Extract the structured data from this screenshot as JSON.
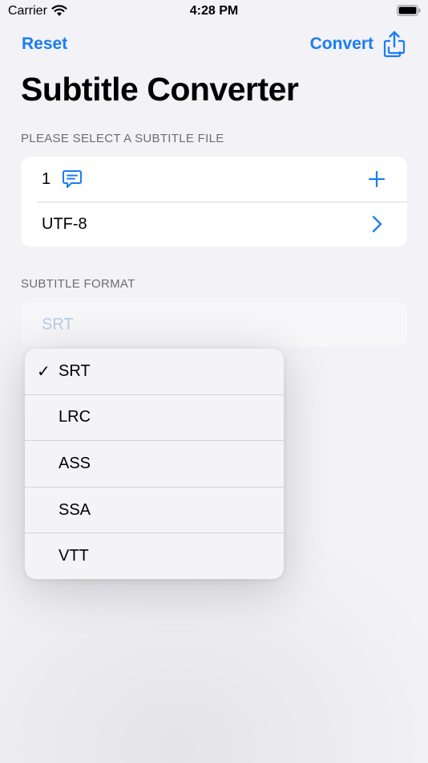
{
  "status_bar": {
    "carrier": "Carrier",
    "time": "4:28 PM"
  },
  "nav": {
    "reset_label": "Reset",
    "convert_label": "Convert",
    "share_icon": "share-icon"
  },
  "title": "Subtitle Converter",
  "file_section": {
    "header": "PLEASE SELECT A SUBTITLE FILE",
    "file_row": {
      "count": "1",
      "icon": "message-icon",
      "trailing_icon": "plus-icon"
    },
    "encoding_row": {
      "label": "UTF-8",
      "trailing_icon": "chevron-right-icon"
    }
  },
  "format_section": {
    "header": "SUBTITLE FORMAT",
    "selected_value": "SRT"
  },
  "format_menu": {
    "items": [
      {
        "label": "SRT",
        "checked": true,
        "check_glyph": "✓"
      },
      {
        "label": "LRC",
        "checked": false
      },
      {
        "label": "ASS",
        "checked": false
      },
      {
        "label": "SSA",
        "checked": false
      },
      {
        "label": "VTT",
        "checked": false
      }
    ]
  },
  "colors": {
    "accent": "#1a7df2",
    "background": "#f2f2f7",
    "secondary_text": "#6d6d72"
  }
}
